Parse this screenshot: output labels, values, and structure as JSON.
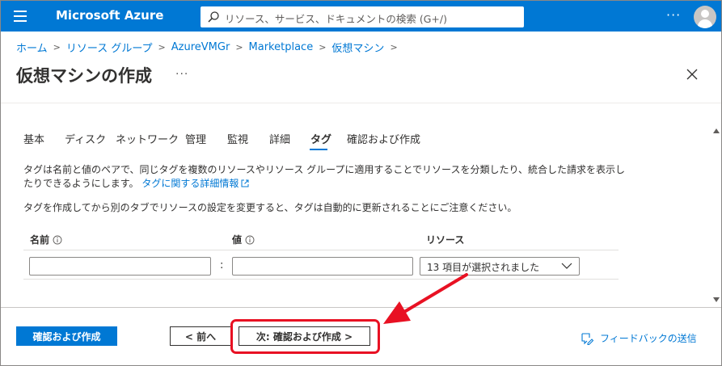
{
  "header": {
    "brand": "Microsoft Azure",
    "search_placeholder": "リソース、サービス、ドキュメントの検索 (G+/)",
    "more": "···"
  },
  "breadcrumb": {
    "items": [
      "ホーム",
      "リソース グループ",
      "AzureVMGr",
      "Marketplace",
      "仮想マシン"
    ],
    "separator": ">"
  },
  "page": {
    "title": "仮想マシンの作成",
    "more": "···"
  },
  "tabs": [
    {
      "label": "基本"
    },
    {
      "label": "ディスク"
    },
    {
      "label": "ネットワーク"
    },
    {
      "label": "管理"
    },
    {
      "label": "監視"
    },
    {
      "label": "詳細"
    },
    {
      "label": "タグ"
    },
    {
      "label": "確認および作成"
    }
  ],
  "active_tab": "タグ",
  "content": {
    "description": "タグは名前と値のペアで、同じタグを複数のリソースやリソース グループに適用することでリソースを分類したり、統合した請求を表示したりできるようにします。",
    "learn_more_link": "タグに関する詳細情報",
    "note": "タグを作成してから別のタブでリソースの設定を変更すると、タグは自動的に更新されることにご注意ください。"
  },
  "tag_grid": {
    "columns": {
      "name": "名前",
      "value": "値",
      "resource": "リソース"
    },
    "row": {
      "name_value": "",
      "value_value": "",
      "separator": ":",
      "resource_selected": "13 項目が選択されました"
    }
  },
  "footer": {
    "review_create": "確認および作成",
    "previous": "< 前へ",
    "next": "次: 確認および作成 >",
    "feedback": "フィードバックの送信"
  },
  "colors": {
    "accent": "#0078d4",
    "annotation_red": "#e81123"
  }
}
